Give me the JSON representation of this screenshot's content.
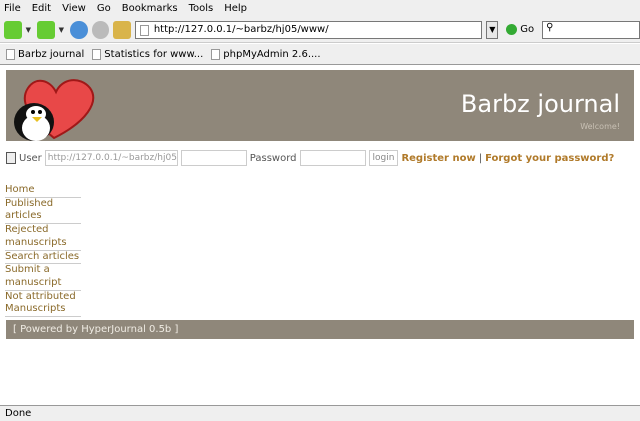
{
  "menu": [
    "File",
    "Edit",
    "View",
    "Go",
    "Bookmarks",
    "Tools",
    "Help"
  ],
  "toolbar": {
    "url": "http://127.0.0.1/~barbz/hj05/www/",
    "go_label": "Go",
    "search_value": ""
  },
  "bookmarks": [
    "Barbz journal",
    "Statistics for www...",
    "phpMyAdmin 2.6...."
  ],
  "header": {
    "title": "Barbz journal",
    "subtitle": "Welcome!"
  },
  "login": {
    "user_label": "User",
    "user_value": "http://127.0.0.1/~barbz/hj05/",
    "extra_value": "",
    "password_label": "Password",
    "login_button": "login",
    "register": "Register now",
    "separator": "|",
    "forgot": "Forgot your password?"
  },
  "nav": [
    "Home",
    "Published articles",
    "Rejected manuscripts",
    "Search articles",
    "Submit a manuscript",
    "Not attributed Manuscripts"
  ],
  "footer": "[ Powered by HyperJournal 0.5b ]",
  "status": "Done",
  "colors": {
    "header_bg": "#8f877a",
    "link": "#b07a2a"
  }
}
